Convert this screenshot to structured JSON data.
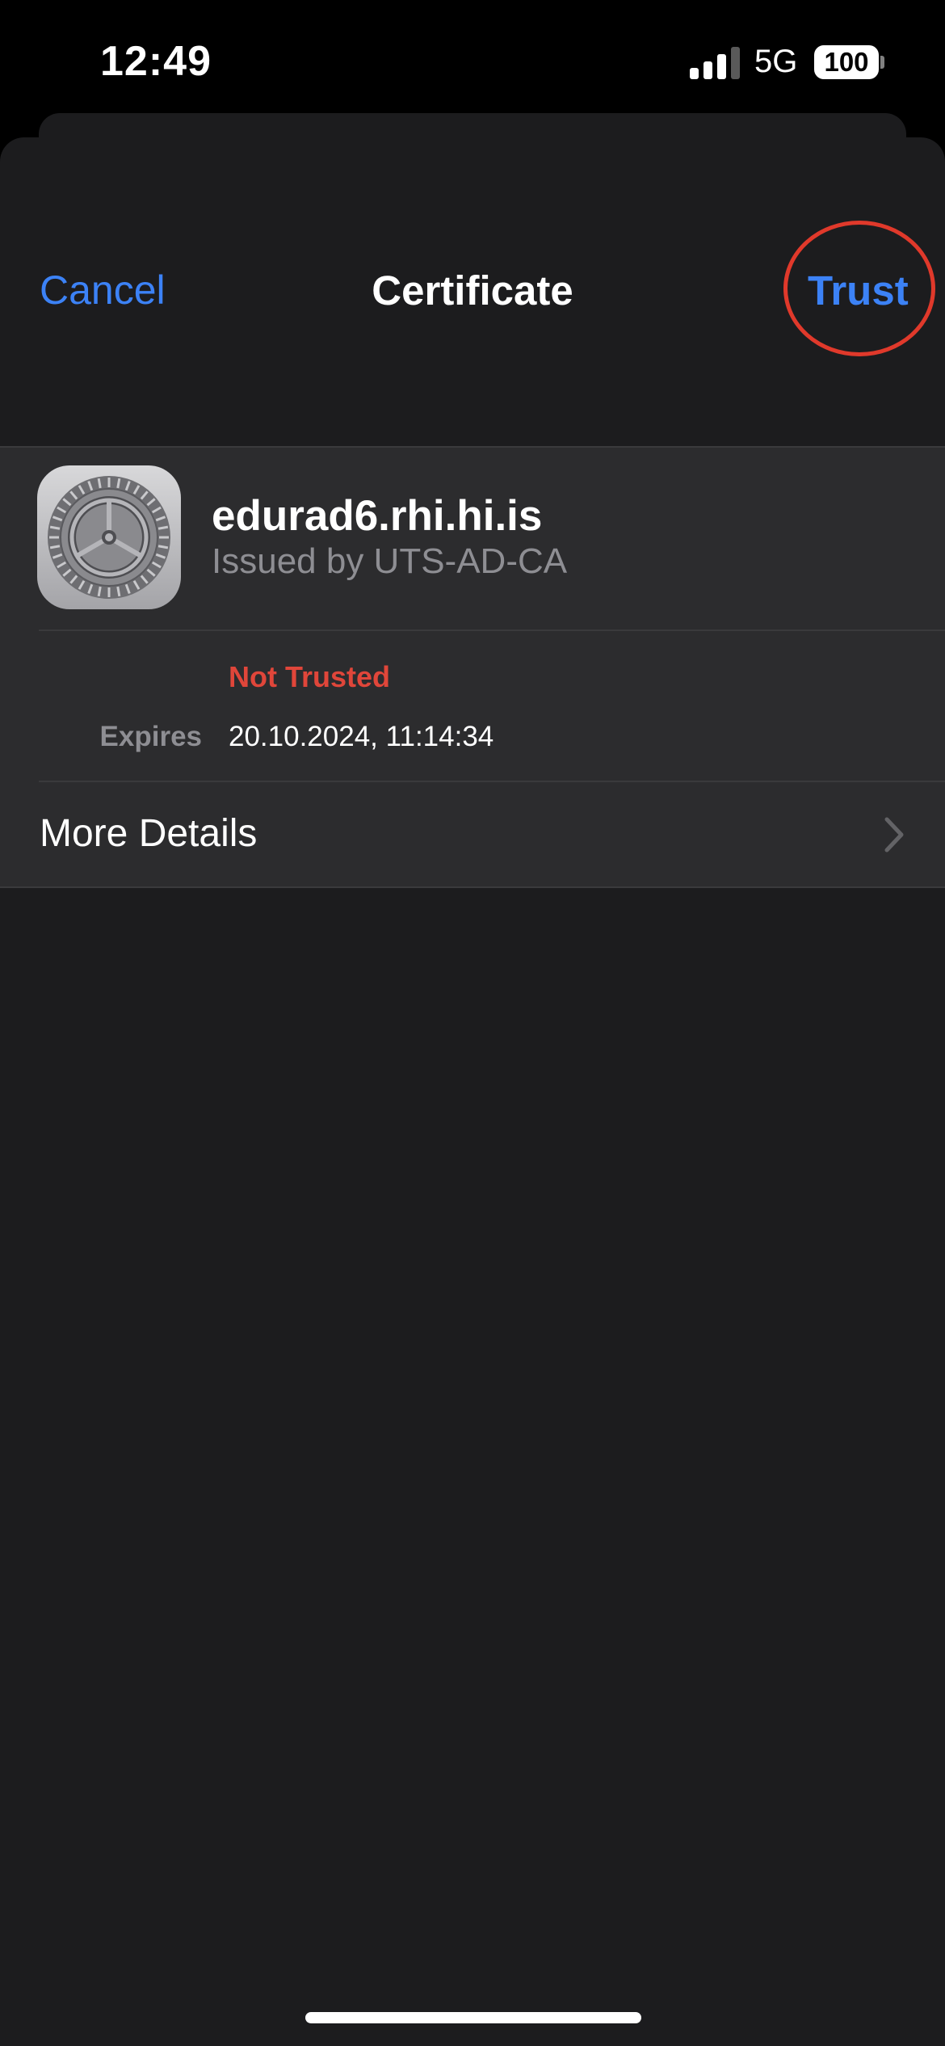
{
  "status_bar": {
    "time": "12:49",
    "network": "5G",
    "battery": "100",
    "signal_bars": 3,
    "signal_bars_total": 4
  },
  "nav": {
    "cancel_label": "Cancel",
    "title": "Certificate",
    "trust_label": "Trust"
  },
  "certificate": {
    "icon": "settings-gear-icon",
    "name": "edurad6.rhi.hi.is",
    "issuer": "Issued by UTS-AD-CA",
    "trust_status": "Not Trusted",
    "expires_label": "Expires",
    "expires_value": "20.10.2024, 11:14:34"
  },
  "more_details": {
    "label": "More Details"
  },
  "colors": {
    "accent": "#3c82f6",
    "danger": "#e0463a",
    "annotation_circle": "#e0392b",
    "sheet_background": "#1c1c1e",
    "group_background": "#2c2c2e"
  }
}
